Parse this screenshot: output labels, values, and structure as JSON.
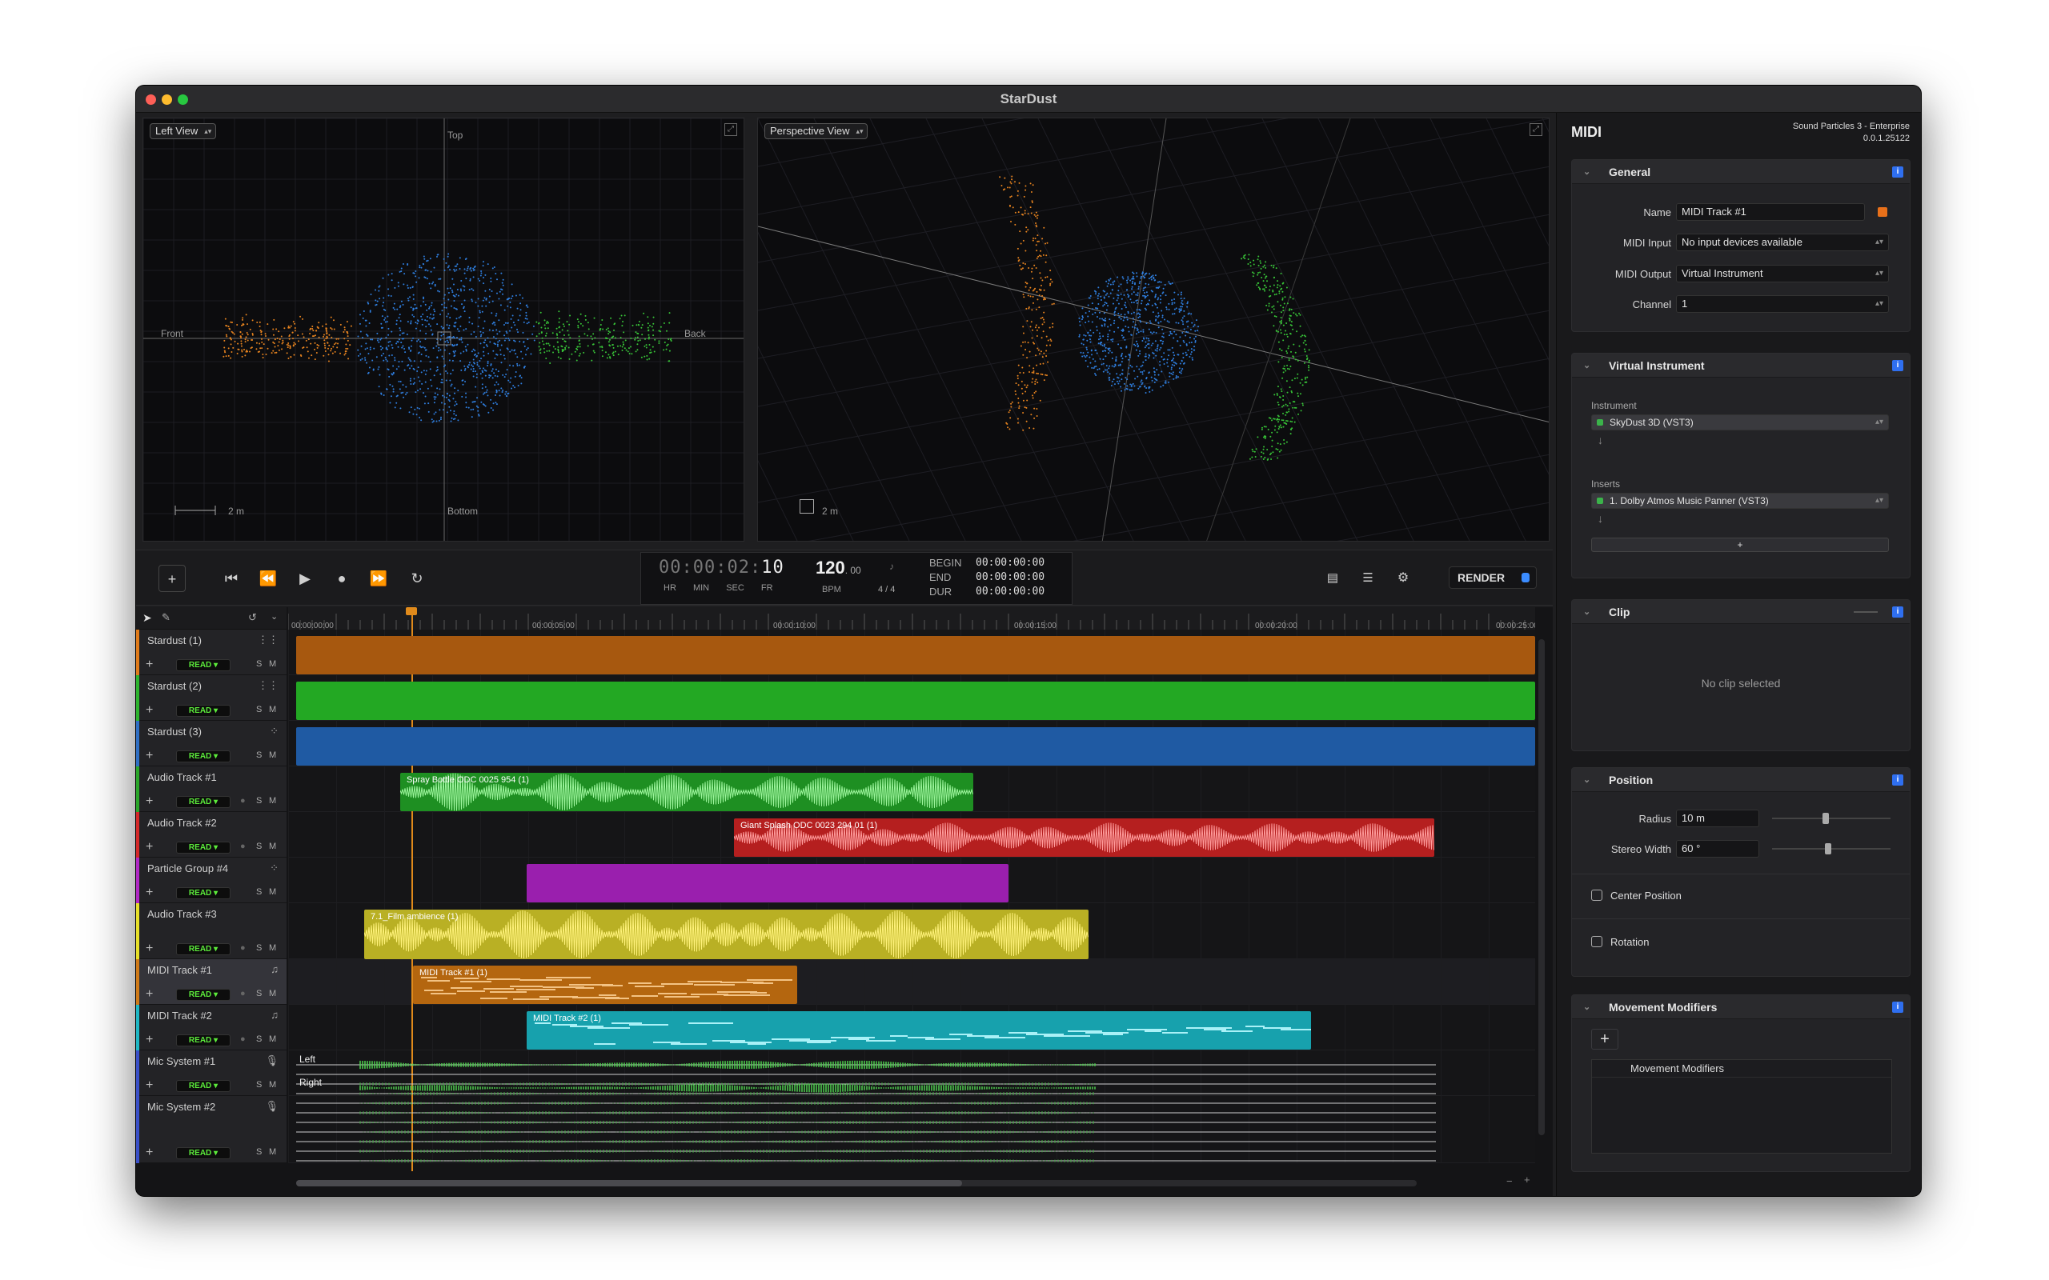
{
  "window": {
    "title": "StarDust"
  },
  "viewports": {
    "left": {
      "view_select": "Left View",
      "top": "Top",
      "bottom": "Bottom",
      "front": "Front",
      "back": "Back",
      "scale": "2 m"
    },
    "perspective": {
      "view_select": "Perspective View",
      "scale": "2 m"
    }
  },
  "transport": {
    "timecode": {
      "hr": "00",
      "min": "00",
      "sec": "02",
      "fr": "10",
      "hr_label": "HR",
      "min_label": "MIN",
      "sec_label": "SEC",
      "fr_label": "FR"
    },
    "tempo": {
      "bpm": "120",
      "bpm_dec": ". 00",
      "bpm_label": "BPM",
      "signature": "4 / 4"
    },
    "begin_label": "BEGIN",
    "begin": "00:00:00:00",
    "end_label": "END",
    "end": "00:00:00:00",
    "dur_label": "DUR",
    "dur": "00:00:00:00",
    "render_label": "RENDER"
  },
  "ruler": [
    "00:00:00:00",
    "00:00:05:00",
    "00:00:10:00",
    "00:00:15:00",
    "00:00:20:00",
    "00:00:25:00"
  ],
  "tracks": [
    {
      "name": "Stardust (1)",
      "read": "READ",
      "s": "S",
      "m": "M",
      "color": "#e07b1a"
    },
    {
      "name": "Stardust (2)",
      "read": "READ",
      "s": "S",
      "m": "M",
      "color": "#2db32d"
    },
    {
      "name": "Stardust (3)",
      "read": "READ",
      "s": "S",
      "m": "M",
      "color": "#2f6fc4"
    },
    {
      "name": "Audio Track #1",
      "read": "READ",
      "s": "S",
      "m": "M",
      "color": "#2aa62a"
    },
    {
      "name": "Audio Track #2",
      "read": "READ",
      "s": "S",
      "m": "M",
      "color": "#d42828"
    },
    {
      "name": "Particle Group #4",
      "read": "READ",
      "s": "S",
      "m": "M",
      "color": "#b027c4"
    },
    {
      "name": "Audio Track #3",
      "read": "READ",
      "s": "S",
      "m": "M",
      "color": "#e6df2a"
    },
    {
      "name": "MIDI Track #1",
      "read": "READ",
      "s": "S",
      "m": "M",
      "color": "#d07a17"
    },
    {
      "name": "MIDI Track #2",
      "read": "READ",
      "s": "S",
      "m": "M",
      "color": "#1fb7c4"
    },
    {
      "name": "Mic System #1",
      "read": "READ",
      "s": "S",
      "m": "M",
      "color": "#3a50c9"
    },
    {
      "name": "Mic System #2",
      "read": "READ",
      "s": "S",
      "m": "M",
      "color": "#3a50c9"
    }
  ],
  "clips": {
    "spray": "Spray Bottle ODC 0025 954 (1)",
    "splash": "Giant Splash ODC 0023 294 01 (1)",
    "film": "7.1_Film ambience (1)",
    "midi1": "MIDI Track #1 (1)",
    "midi2": "MIDI Track #2 (1)",
    "mic_left": "Left",
    "mic_right": "Right"
  },
  "panel": {
    "title": "MIDI",
    "product": "Sound Particles 3 - Enterprise",
    "version": "0.0.1.25122",
    "general": {
      "title": "General",
      "name_label": "Name",
      "name_value": "MIDI Track #1",
      "midi_input_label": "MIDI Input",
      "midi_input_value": "No input devices available",
      "midi_output_label": "MIDI Output",
      "midi_output_value": "Virtual Instrument",
      "channel_label": "Channel",
      "channel_value": "1"
    },
    "virtual_instrument": {
      "title": "Virtual Instrument",
      "instrument_label": "Instrument",
      "instrument_value": "SkyDust 3D (VST3)",
      "inserts_label": "Inserts",
      "insert_value": "1. Dolby Atmos Music Panner (VST3)",
      "add": "+"
    },
    "clip": {
      "title": "Clip",
      "empty": "No clip selected"
    },
    "position": {
      "title": "Position",
      "radius_label": "Radius",
      "radius_value": "10 m",
      "radius_slider": 0.45,
      "stereo_label": "Stereo Width",
      "stereo_value": "60 °",
      "stereo_slider": 0.47,
      "center_label": "Center Position",
      "rotation_label": "Rotation"
    },
    "movement": {
      "title": "Movement Modifiers",
      "add": "+",
      "list_header": "Movement Modifiers"
    }
  }
}
